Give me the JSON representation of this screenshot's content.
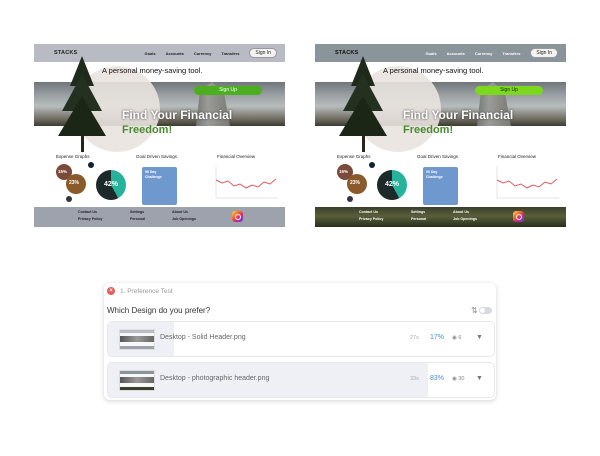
{
  "designs": [
    {
      "brand": "STACKS",
      "nav": [
        "Goals",
        "Accounts",
        "Currency",
        "Transfers"
      ],
      "sign_in": "Sign In",
      "tagline": "A personal money-saving tool.",
      "cta": "Sign Up",
      "title_line1": "Find Your Financial",
      "title_line2": "Freedom!",
      "features": {
        "expense": "Expense Graphs",
        "goals": "Goal Driven Savings",
        "overview": "Financial Overview",
        "pie_a": "15%",
        "pie_b": "23%",
        "pie_c": "42%",
        "card_line1": "90 Day",
        "card_line2": "Challenge"
      },
      "footer": {
        "contact": "Contact Us",
        "settings": "Settings",
        "about": "About Us",
        "privacy": "Privacy Policy",
        "personal": "Personal",
        "jobs": "Job Openings"
      }
    },
    {
      "brand": "STACKS",
      "nav": [
        "Goals",
        "Accounts",
        "Currency",
        "Transfers"
      ],
      "sign_in": "Sign In",
      "tagline": "A personal money-saving tool.",
      "cta": "Sign Up",
      "title_line1": "Find Your Financial",
      "title_line2": "Freedom!",
      "features": {
        "expense": "Expense Graphs",
        "goals": "Goal Driven Savings",
        "overview": "Financial Overview",
        "pie_a": "15%",
        "pie_b": "23%",
        "pie_c": "42%",
        "card_line1": "90 Day",
        "card_line2": "Challenge"
      },
      "footer": {
        "contact": "Contact Us",
        "settings": "Settings",
        "about": "About Us",
        "privacy": "Privacy Policy",
        "personal": "Personal",
        "jobs": "Job Openings"
      }
    }
  ],
  "panel": {
    "task_label": "1. Preference Test",
    "question": "Which Design do you prefer?",
    "rows": [
      {
        "file": "Desktop - Solid Header.png",
        "time": "27s",
        "percent": "17%",
        "users": "6",
        "share": 0.17
      },
      {
        "file": "Desktop - photographic header.png",
        "time": "33s",
        "percent": "83%",
        "users": "30",
        "share": 0.83
      }
    ]
  },
  "colors": {
    "accent_blue": "#4a8fd6",
    "error_red": "#e85a5a",
    "cta_green": "#4caf1f"
  },
  "icons": {
    "task_status": "error-icon",
    "sort": "sort-icon",
    "filter": "filter-icon",
    "users": "users-icon",
    "social": "instagram-icon"
  }
}
